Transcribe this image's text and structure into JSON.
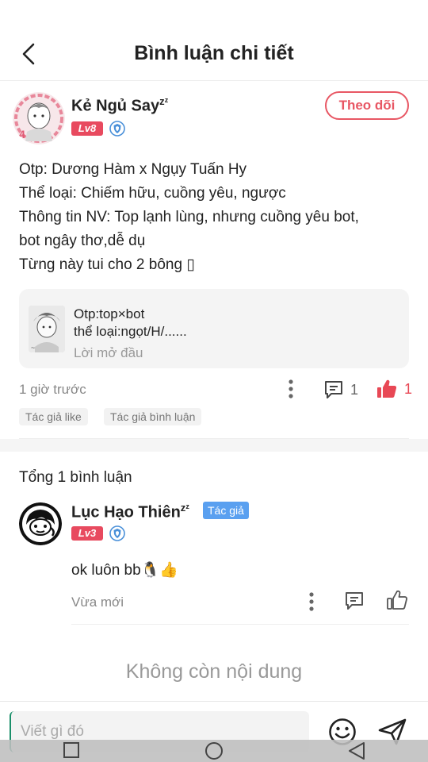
{
  "header": {
    "title": "Bình luận chi tiết"
  },
  "post": {
    "author": {
      "name": "Kẻ Ngủ Say",
      "name_suffix": "zᶻ",
      "level": "Lv8"
    },
    "follow_label": "Theo dõi",
    "lines": [
      "Otp: Dương Hàm x Ngụy Tuấn Hy",
      "Thể loại: Chiếm hữu, cuồng yêu, ngược",
      "Thông tin NV: Top lạnh lùng, nhưng cuồng yêu bot,",
      "bot ngây thơ,dễ dụ",
      "Từng này tui cho 2 bông ▯"
    ],
    "quote": {
      "line1": "Otp:top×bot",
      "line2": "thể loại:ngọt/H/......",
      "line3": "Lời mở đầu"
    },
    "time": "1 giờ trước",
    "comment_count": "1",
    "like_count": "1",
    "tags": [
      "Tác giả like",
      "Tác giả bình luận"
    ]
  },
  "comments": {
    "total_label": "Tổng 1 bình luận",
    "items": [
      {
        "name": "Lục Hạo Thiên",
        "name_suffix": "zᶻ",
        "author_badge": "Tác giả",
        "level": "Lv3",
        "text": "ok luôn bb🐧👍",
        "time": "Vừa mới"
      }
    ]
  },
  "footer": {
    "no_more": "Không còn nội dung"
  },
  "input": {
    "placeholder": "Viết gì đó"
  },
  "colors": {
    "accent": "#e85764",
    "like_red": "#e84855",
    "author_blue": "#5aa0f0",
    "level_red": "#e84a5f"
  }
}
